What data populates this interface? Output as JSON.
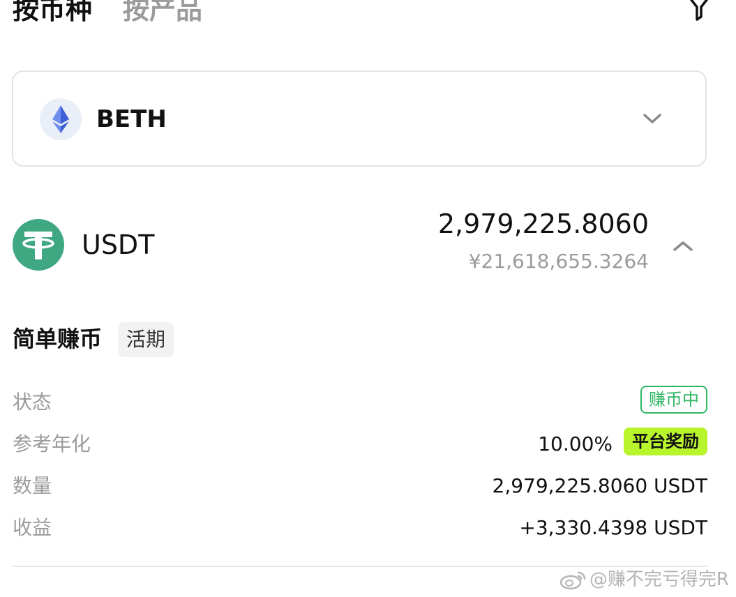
{
  "tabs": [
    {
      "label": "按币种",
      "active": true
    },
    {
      "label": "按产品",
      "active": false
    }
  ],
  "filter_icon": "filter-icon",
  "coin_selector": {
    "icon": "ethereum-icon",
    "label": "BETH",
    "chevron_icon": "chevron-down-icon"
  },
  "asset": {
    "icon": "tether-icon",
    "name": "USDT",
    "amount": "2,979,225.8060",
    "fiat_value": "¥21,618,655.3264",
    "chevron_icon": "chevron-up-icon"
  },
  "product": {
    "title": "简单赚币",
    "tag": "活期",
    "rows": {
      "status": {
        "label": "状态",
        "value": "赚币中"
      },
      "apr": {
        "label": "参考年化",
        "value": "10.00%",
        "badge": "平台奖励"
      },
      "quantity": {
        "label": "数量",
        "value": "2,979,225.8060 USDT"
      },
      "earnings": {
        "label": "收益",
        "value": "+3,330.4398 USDT"
      }
    }
  },
  "watermark": {
    "icon": "weibo-icon",
    "text": "@赚不完亏得完R"
  },
  "colors": {
    "accent_green": "#2fb866",
    "bonus_lime": "#b9f52d",
    "usdt_green": "#3fa882",
    "eth_blue": "#627eea",
    "muted_text": "#9b9b9b"
  }
}
